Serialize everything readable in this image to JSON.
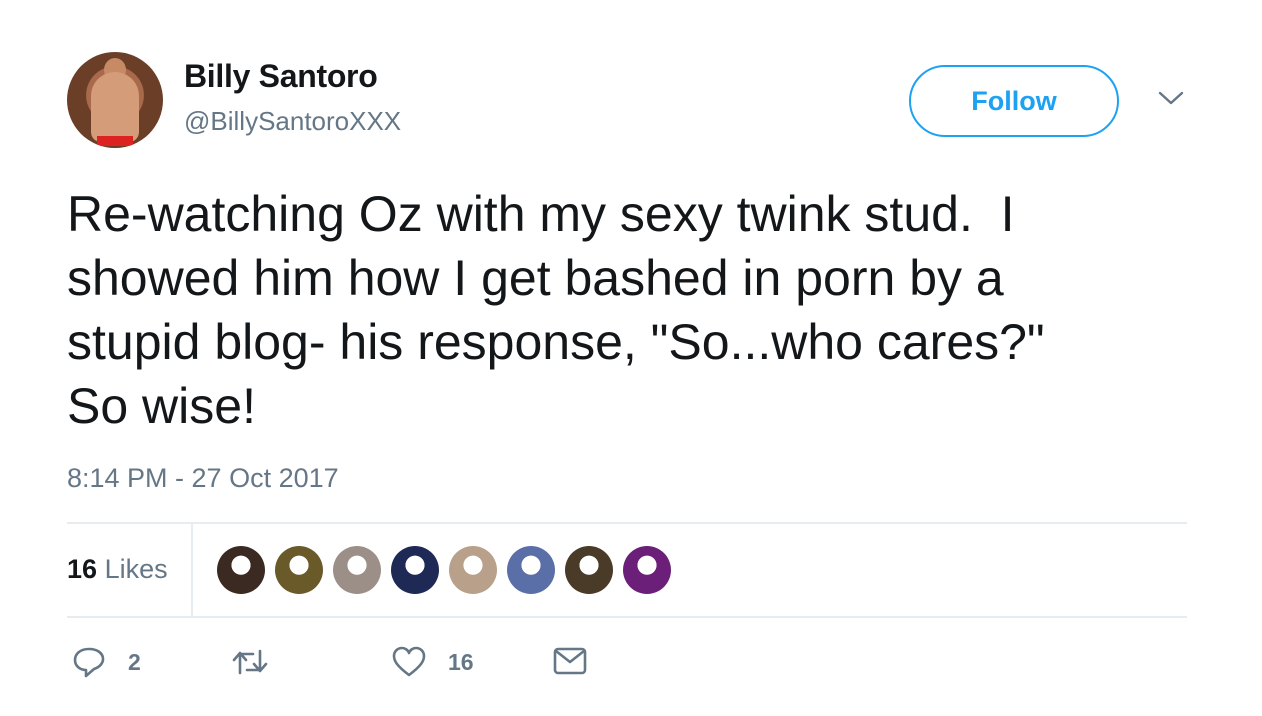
{
  "author": {
    "name": "Billy Santoro",
    "handle": "@BillySantoroXXX",
    "avatar_icon": "profile-photo-avatar"
  },
  "follow_button": {
    "label": "Follow",
    "color": "#1da1f2"
  },
  "tweet": {
    "text": "Re-watching Oz with my sexy twink stud.  I\nshowed him how I get bashed in porn by a\nstupid blog- his response, \"So...who cares?\"\nSo wise!",
    "timestamp": "8:14 PM - 27 Oct 2017"
  },
  "stats": {
    "likes_count": "16",
    "likes_label": "Likes",
    "liker_avatars": [
      {
        "name": "liker-avatar-1",
        "color": "#3a2a22"
      },
      {
        "name": "liker-avatar-2",
        "color": "#6a5a2a"
      },
      {
        "name": "liker-avatar-3",
        "color": "#9c8f88"
      },
      {
        "name": "liker-avatar-4",
        "color": "#1e2a55"
      },
      {
        "name": "liker-avatar-5",
        "color": "#b8a08a"
      },
      {
        "name": "liker-avatar-6",
        "color": "#5a6ea8"
      },
      {
        "name": "liker-avatar-7",
        "color": "#4a3a28"
      },
      {
        "name": "liker-avatar-8",
        "color": "#6b1f78"
      }
    ]
  },
  "actions": {
    "reply": {
      "icon": "reply-icon",
      "count": "2"
    },
    "retweet": {
      "icon": "retweet-icon",
      "count": ""
    },
    "like": {
      "icon": "heart-icon",
      "count": "16"
    },
    "message": {
      "icon": "envelope-icon",
      "count": ""
    }
  },
  "colors": {
    "text": "#14171a",
    "secondary": "#657786",
    "divider": "#e6ecf0"
  }
}
